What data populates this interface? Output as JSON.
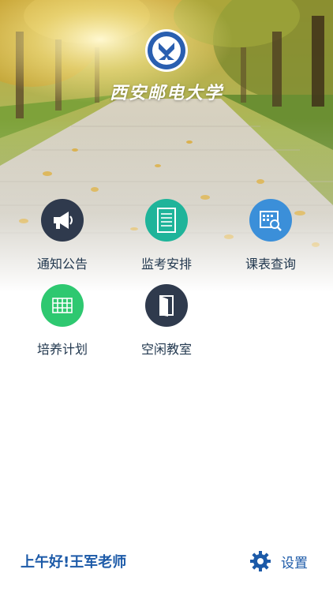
{
  "header": {
    "school_name": "西安邮电大学"
  },
  "menu": [
    {
      "label": "通知公告",
      "icon": "megaphone-icon",
      "color": "#2f3a4d"
    },
    {
      "label": "监考安排",
      "icon": "document-icon",
      "color": "#1fb49a"
    },
    {
      "label": "课表查询",
      "icon": "calendar-search-icon",
      "color": "#3b8fd9"
    },
    {
      "label": "培养计划",
      "icon": "table-grid-icon",
      "color": "#2ec870"
    },
    {
      "label": "空闲教室",
      "icon": "open-door-icon",
      "color": "#2f3a4d"
    }
  ],
  "footer": {
    "greeting": "上午好!王军老师",
    "settings_label": "设置"
  },
  "colors": {
    "accent": "#1c5aa8",
    "menu_text": "#22384f"
  }
}
